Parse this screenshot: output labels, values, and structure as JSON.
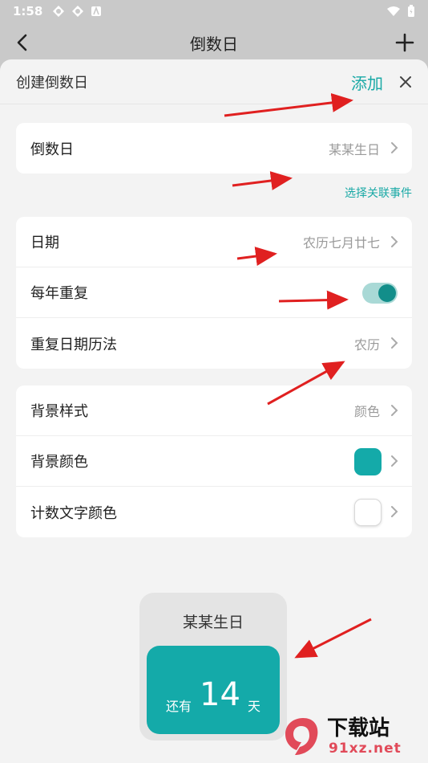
{
  "status_bar": {
    "time": "1:58"
  },
  "top_nav": {
    "title": "倒数日"
  },
  "sheet": {
    "title": "创建倒数日",
    "add_label": "添加"
  },
  "card_event": {
    "label": "倒数日",
    "value": "某某生日"
  },
  "link": {
    "label": "选择关联事件"
  },
  "card_date": {
    "date_label": "日期",
    "date_value": "农历七月廿七",
    "repeat_label": "每年重复",
    "repeat_on": true,
    "calendar_label": "重复日期历法",
    "calendar_value": "农历"
  },
  "card_style": {
    "style_label": "背景样式",
    "style_value": "颜色",
    "bg_color_label": "背景颜色",
    "bg_color": "#14aaa9",
    "text_color_label": "计数文字颜色",
    "text_color": "#ffffff"
  },
  "preview": {
    "title": "某某生日",
    "prefix": "还有",
    "number": "14",
    "suffix": "天"
  },
  "colors": {
    "accent": "#1aa9a6",
    "arrow": "#e02020"
  },
  "watermark": {
    "text": "下载站",
    "url": "91xz.net"
  }
}
